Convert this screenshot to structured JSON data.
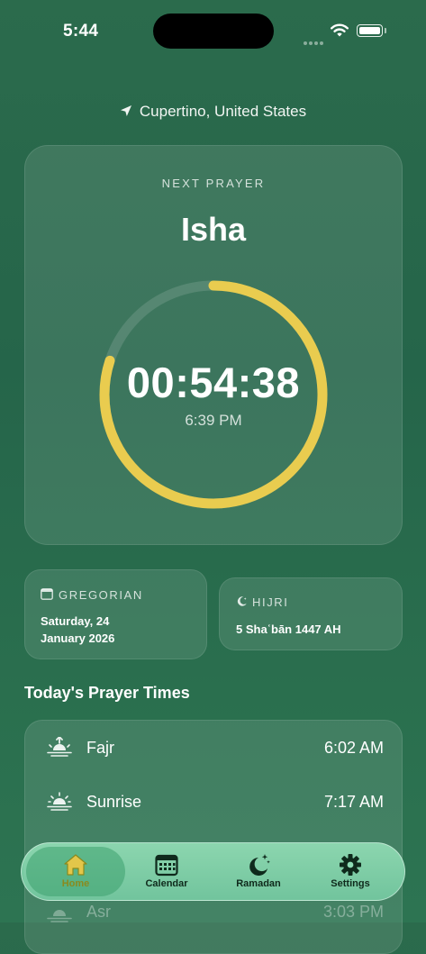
{
  "status_bar": {
    "time": "5:44"
  },
  "location": {
    "text": "Cupertino, United States"
  },
  "next_prayer": {
    "label": "NEXT PRAYER",
    "name": "Isha",
    "countdown": "00:54:38",
    "time": "6:39 PM",
    "progress_fraction": 0.8,
    "ring_color": "#e9cc4f"
  },
  "gregorian": {
    "label": "GREGORIAN",
    "line1": "Saturday, 24",
    "line2": "January 2026"
  },
  "hijri": {
    "label": "HIJRI",
    "value": "5 Shaʿbān 1447 AH"
  },
  "prayer_times": {
    "title": "Today's Prayer Times",
    "rows": [
      {
        "name": "Fajr",
        "time": "6:02 AM",
        "icon": "sunrise-arrow-icon"
      },
      {
        "name": "Sunrise",
        "time": "7:17 AM",
        "icon": "sun-horizon-icon"
      },
      {
        "name": "Asr",
        "time": "3:03 PM",
        "icon": "sun-horizon-icon"
      }
    ]
  },
  "tab_bar": {
    "items": [
      {
        "label": "Home",
        "icon": "house-icon",
        "active": true
      },
      {
        "label": "Calendar",
        "icon": "calendar-icon",
        "active": false
      },
      {
        "label": "Ramadan",
        "icon": "moon-star-icon",
        "active": false
      },
      {
        "label": "Settings",
        "icon": "gear-icon",
        "active": false
      }
    ]
  }
}
